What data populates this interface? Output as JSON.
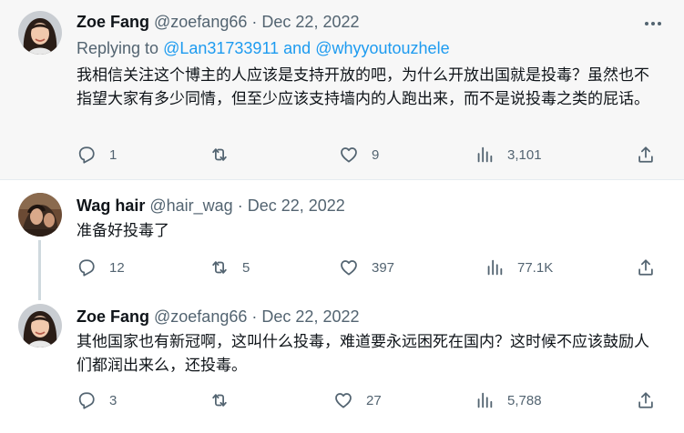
{
  "tweets": [
    {
      "name": "Zoe Fang",
      "handle": "@zoefang66",
      "separator": "·",
      "date": "Dec 22, 2022",
      "replying_prefix": "Replying to",
      "replying_user1": "@Lan31733911",
      "replying_and": "and",
      "replying_user2": "@whyyoutouzhele",
      "text": "我相信关注这个博主的人应该是支持开放的吧，为什么开放出国就是投毒？虽然也不指望大家有多少同情，但至少应该支持墙内的人跑出来，而不是说投毒之类的屁话。",
      "replies": "1",
      "retweets": "",
      "likes": "9",
      "views": "3,101"
    },
    {
      "name": "Wag hair",
      "handle": "@hair_wag",
      "separator": "·",
      "date": "Dec 22, 2022",
      "text": "准备好投毒了",
      "replies": "12",
      "retweets": "5",
      "likes": "397",
      "views": "77.1K"
    },
    {
      "name": "Zoe Fang",
      "handle": "@zoefang66",
      "separator": "·",
      "date": "Dec 22, 2022",
      "text": "其他国家也有新冠啊，这叫什么投毒，难道要永远困死在国内？这时候不应该鼓励人们都润出来么，还投毒。",
      "replies": "3",
      "retweets": "",
      "likes": "27",
      "views": "5,788"
    }
  ],
  "colors": {
    "text": "#0f1419",
    "secondary": "#536471",
    "link": "#1d9bf0",
    "highlight_bg": "#f7f7f7",
    "thread_line": "#cfd9de"
  },
  "icons": {
    "reply": "reply-icon",
    "retweet": "retweet-icon",
    "like": "heart-icon",
    "views": "views-icon",
    "share": "share-icon",
    "more": "more-icon"
  }
}
